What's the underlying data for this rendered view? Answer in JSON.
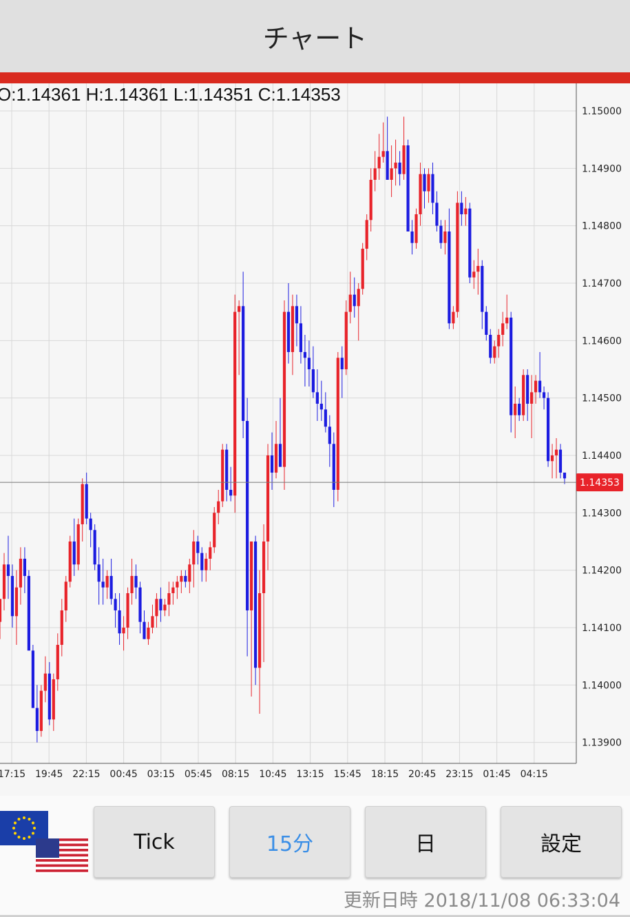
{
  "header": {
    "title": "チャート"
  },
  "ohlc_text": "O:1.14361 H:1.14361 L:1.14351 C:1.14353",
  "chart_data": {
    "type": "candlestick",
    "symbol_pair": "EUR/USD",
    "ylim": [
      1.1385,
      1.1506
    ],
    "y_ticks": [
      "1.15000",
      "1.14900",
      "1.14800",
      "1.14700",
      "1.14600",
      "1.14500",
      "1.14400",
      "1.14300",
      "1.14200",
      "1.14100",
      "1.14000",
      "1.13900"
    ],
    "x_ticks": [
      "17:15",
      "19:45",
      "22:15",
      "00:45",
      "03:15",
      "05:45",
      "08:15",
      "10:45",
      "13:15",
      "15:45",
      "18:15",
      "20:45",
      "23:15",
      "01:45",
      "04:15"
    ],
    "current_price": 1.14353,
    "current_price_label": "1.14353",
    "up_color": "#e8232a",
    "down_color": "#1c1ce0",
    "grid": true,
    "candles": [
      [
        1.1411,
        1.1415,
        1.1408,
        1.1415
      ],
      [
        1.1415,
        1.1423,
        1.1413,
        1.1421
      ],
      [
        1.1421,
        1.1426,
        1.1415,
        1.1419
      ],
      [
        1.1419,
        1.1421,
        1.141,
        1.1412
      ],
      [
        1.1412,
        1.142,
        1.1407,
        1.1417
      ],
      [
        1.1417,
        1.1424,
        1.1414,
        1.1422
      ],
      [
        1.1422,
        1.1424,
        1.1416,
        1.1419
      ],
      [
        1.1419,
        1.142,
        1.1408,
        1.1406
      ],
      [
        1.1406,
        1.1407,
        1.1397,
        1.1396
      ],
      [
        1.1396,
        1.14,
        1.139,
        1.1392
      ],
      [
        1.1392,
        1.14,
        1.1391,
        1.1399
      ],
      [
        1.1399,
        1.1405,
        1.1397,
        1.1402
      ],
      [
        1.1402,
        1.1404,
        1.1393,
        1.1394
      ],
      [
        1.1394,
        1.1402,
        1.1392,
        1.1401
      ],
      [
        1.1401,
        1.1409,
        1.1399,
        1.1407
      ],
      [
        1.1407,
        1.1415,
        1.1405,
        1.1413
      ],
      [
        1.1413,
        1.1419,
        1.1411,
        1.1418
      ],
      [
        1.1418,
        1.1426,
        1.1417,
        1.1425
      ],
      [
        1.1425,
        1.1429,
        1.1419,
        1.1421
      ],
      [
        1.1421,
        1.1429,
        1.142,
        1.1428
      ],
      [
        1.1428,
        1.1436,
        1.1425,
        1.1435
      ],
      [
        1.1435,
        1.1437,
        1.1428,
        1.1429
      ],
      [
        1.1429,
        1.143,
        1.1424,
        1.1427
      ],
      [
        1.1427,
        1.1428,
        1.142,
        1.1421
      ],
      [
        1.1421,
        1.1424,
        1.1414,
        1.1418
      ],
      [
        1.1418,
        1.1422,
        1.1414,
        1.1417
      ],
      [
        1.1417,
        1.142,
        1.1415,
        1.1419
      ],
      [
        1.1419,
        1.1422,
        1.1414,
        1.1415
      ],
      [
        1.1415,
        1.1416,
        1.141,
        1.1413
      ],
      [
        1.1413,
        1.1416,
        1.1407,
        1.1409
      ],
      [
        1.1409,
        1.1412,
        1.1406,
        1.141
      ],
      [
        1.141,
        1.1417,
        1.1408,
        1.1416
      ],
      [
        1.1416,
        1.1422,
        1.1414,
        1.1419
      ],
      [
        1.1419,
        1.1421,
        1.1415,
        1.1417
      ],
      [
        1.1417,
        1.1418,
        1.1409,
        1.1411
      ],
      [
        1.1411,
        1.1413,
        1.1408,
        1.1408
      ],
      [
        1.1408,
        1.1411,
        1.1407,
        1.141
      ],
      [
        1.141,
        1.1414,
        1.1409,
        1.1412
      ],
      [
        1.1412,
        1.1416,
        1.141,
        1.1415
      ],
      [
        1.1415,
        1.1417,
        1.1411,
        1.1413
      ],
      [
        1.1413,
        1.1415,
        1.1412,
        1.1414
      ],
      [
        1.1414,
        1.1418,
        1.1412,
        1.1416
      ],
      [
        1.1416,
        1.1418,
        1.1414,
        1.1417
      ],
      [
        1.1417,
        1.1419,
        1.1415,
        1.1418
      ],
      [
        1.1418,
        1.142,
        1.1416,
        1.1419
      ],
      [
        1.1419,
        1.142,
        1.1417,
        1.1418
      ],
      [
        1.1418,
        1.1422,
        1.1416,
        1.1421
      ],
      [
        1.1421,
        1.1427,
        1.1417,
        1.1425
      ],
      [
        1.1425,
        1.1426,
        1.1421,
        1.1423
      ],
      [
        1.1423,
        1.1424,
        1.1418,
        1.142
      ],
      [
        1.142,
        1.1423,
        1.1418,
        1.1422
      ],
      [
        1.1422,
        1.1425,
        1.142,
        1.1424
      ],
      [
        1.1424,
        1.1431,
        1.1423,
        1.143
      ],
      [
        1.143,
        1.1434,
        1.1428,
        1.1432
      ],
      [
        1.1432,
        1.1442,
        1.1431,
        1.1441
      ],
      [
        1.1441,
        1.1442,
        1.1432,
        1.1434
      ],
      [
        1.1434,
        1.1438,
        1.1432,
        1.1433
      ],
      [
        1.1433,
        1.1468,
        1.143,
        1.1465
      ],
      [
        1.1465,
        1.1467,
        1.1454,
        1.1466
      ],
      [
        1.1466,
        1.1472,
        1.1443,
        1.1446
      ],
      [
        1.1446,
        1.145,
        1.1405,
        1.1413
      ],
      [
        1.1413,
        1.1414,
        1.1398,
        1.1425
      ],
      [
        1.1425,
        1.1426,
        1.14,
        1.1403
      ],
      [
        1.1403,
        1.142,
        1.1395,
        1.1416
      ],
      [
        1.1416,
        1.1428,
        1.1404,
        1.1425
      ],
      [
        1.1425,
        1.1442,
        1.142,
        1.144
      ],
      [
        1.144,
        1.1444,
        1.1434,
        1.1437
      ],
      [
        1.1437,
        1.1446,
        1.1436,
        1.1442
      ],
      [
        1.1442,
        1.145,
        1.1439,
        1.1438
      ],
      [
        1.1438,
        1.1467,
        1.1434,
        1.1465
      ],
      [
        1.1465,
        1.147,
        1.1456,
        1.1458
      ],
      [
        1.1458,
        1.1468,
        1.1454,
        1.1466
      ],
      [
        1.1466,
        1.1468,
        1.1459,
        1.1463
      ],
      [
        1.1463,
        1.1466,
        1.1456,
        1.1458
      ],
      [
        1.1458,
        1.1461,
        1.1452,
        1.1457
      ],
      [
        1.1457,
        1.146,
        1.1452,
        1.1455
      ],
      [
        1.1455,
        1.1459,
        1.145,
        1.1451
      ],
      [
        1.1451,
        1.1455,
        1.1446,
        1.1449
      ],
      [
        1.1449,
        1.1453,
        1.1446,
        1.1448
      ],
      [
        1.1448,
        1.1451,
        1.1444,
        1.1445
      ],
      [
        1.1445,
        1.1447,
        1.1438,
        1.1442
      ],
      [
        1.1442,
        1.1444,
        1.1431,
        1.1434
      ],
      [
        1.1434,
        1.1458,
        1.1432,
        1.1457
      ],
      [
        1.1457,
        1.1459,
        1.145,
        1.1455
      ],
      [
        1.1455,
        1.1467,
        1.1454,
        1.1465
      ],
      [
        1.1465,
        1.1472,
        1.1463,
        1.1468
      ],
      [
        1.1468,
        1.1471,
        1.1464,
        1.1466
      ],
      [
        1.1466,
        1.147,
        1.146,
        1.1469
      ],
      [
        1.1469,
        1.1477,
        1.1468,
        1.1476
      ],
      [
        1.1476,
        1.1482,
        1.1474,
        1.1481
      ],
      [
        1.1481,
        1.149,
        1.1479,
        1.1488
      ],
      [
        1.1488,
        1.1493,
        1.1486,
        1.149
      ],
      [
        1.149,
        1.1496,
        1.1488,
        1.1492
      ],
      [
        1.1492,
        1.1498,
        1.1491,
        1.1493
      ],
      [
        1.1493,
        1.1499,
        1.1488,
        1.1488
      ],
      [
        1.1488,
        1.1494,
        1.1485,
        1.149
      ],
      [
        1.149,
        1.1495,
        1.1487,
        1.1491
      ],
      [
        1.1491,
        1.1493,
        1.1487,
        1.1489
      ],
      [
        1.1489,
        1.1499,
        1.1488,
        1.1494
      ],
      [
        1.1494,
        1.1495,
        1.1485,
        1.1479
      ],
      [
        1.1479,
        1.1481,
        1.1475,
        1.1477
      ],
      [
        1.1477,
        1.1483,
        1.1476,
        1.1482
      ],
      [
        1.1482,
        1.1491,
        1.148,
        1.1489
      ],
      [
        1.1489,
        1.149,
        1.1483,
        1.1486
      ],
      [
        1.1486,
        1.149,
        1.1484,
        1.1489
      ],
      [
        1.1489,
        1.1491,
        1.1482,
        1.1484
      ],
      [
        1.1484,
        1.1486,
        1.1479,
        1.148
      ],
      [
        1.148,
        1.1481,
        1.1476,
        1.1477
      ],
      [
        1.1477,
        1.1481,
        1.1475,
        1.1479
      ],
      [
        1.1479,
        1.1483,
        1.1462,
        1.1463
      ],
      [
        1.1463,
        1.1466,
        1.1462,
        1.1465
      ],
      [
        1.1465,
        1.1486,
        1.1464,
        1.1484
      ],
      [
        1.1484,
        1.1486,
        1.148,
        1.1482
      ],
      [
        1.1482,
        1.1485,
        1.148,
        1.1483
      ],
      [
        1.1483,
        1.1484,
        1.147,
        1.1471
      ],
      [
        1.1471,
        1.1474,
        1.1469,
        1.1472
      ],
      [
        1.1472,
        1.1476,
        1.1468,
        1.1473
      ],
      [
        1.1473,
        1.1474,
        1.1462,
        1.1465
      ],
      [
        1.1465,
        1.1466,
        1.146,
        1.1461
      ],
      [
        1.1461,
        1.1462,
        1.1456,
        1.1457
      ],
      [
        1.1457,
        1.146,
        1.1456,
        1.1459
      ],
      [
        1.1459,
        1.1462,
        1.1457,
        1.1461
      ],
      [
        1.1461,
        1.1465,
        1.1459,
        1.1463
      ],
      [
        1.1463,
        1.1468,
        1.1462,
        1.1464
      ],
      [
        1.1464,
        1.1465,
        1.1444,
        1.1447
      ],
      [
        1.1447,
        1.1452,
        1.1443,
        1.1449
      ],
      [
        1.1449,
        1.145,
        1.1446,
        1.1447
      ],
      [
        1.1447,
        1.1455,
        1.1446,
        1.1454
      ],
      [
        1.1454,
        1.1455,
        1.1446,
        1.1449
      ],
      [
        1.1449,
        1.1454,
        1.1443,
        1.1451
      ],
      [
        1.1451,
        1.1454,
        1.1449,
        1.1453
      ],
      [
        1.1453,
        1.1458,
        1.145,
        1.1451
      ],
      [
        1.1451,
        1.1452,
        1.1448,
        1.145
      ],
      [
        1.145,
        1.1451,
        1.1438,
        1.1439
      ],
      [
        1.1439,
        1.1442,
        1.1436,
        1.144
      ],
      [
        1.144,
        1.1443,
        1.1436,
        1.1441
      ],
      [
        1.1441,
        1.1442,
        1.1436,
        1.1437
      ],
      [
        1.1437,
        1.1437,
        1.1435,
        1.1436
      ]
    ]
  },
  "pair_icon": {
    "base": "eu-flag-icon",
    "quote": "us-flag-icon"
  },
  "buttons": {
    "tick": "Tick",
    "m15": "15分",
    "day": "日",
    "settings": "設定"
  },
  "colors": {
    "accent_red": "#d92a1f",
    "active_blue": "#3a8ee6"
  },
  "update_label": "更新日時",
  "update_time": "2018/11/08 06:33:04"
}
